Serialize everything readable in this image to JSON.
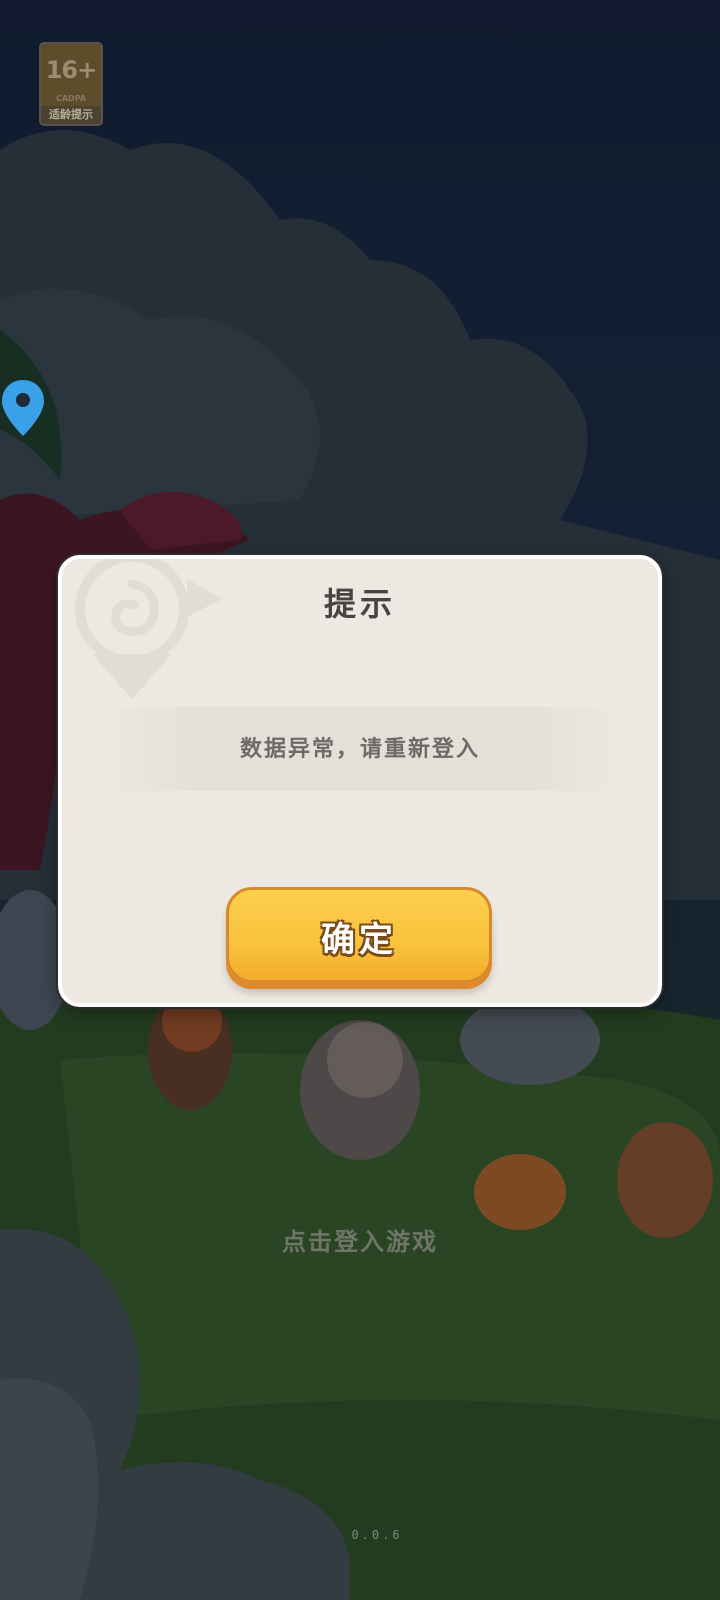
{
  "age_rating": {
    "number": "16+",
    "sub_text": "CADPA",
    "caption": "适龄提示"
  },
  "dialog": {
    "title": "提示",
    "message": "数据异常，请重新登入",
    "confirm_label": "确定"
  },
  "start_prompt": "点击登入游戏",
  "version": "0.0.6",
  "colors": {
    "dialog_bg": "#ede9e2",
    "button_yellow": "#f9c23d",
    "button_border": "#d88a2a",
    "pin_blue": "#3aa0e8"
  },
  "icons": {
    "location": "location-pin-icon",
    "emblem": "dialog-emblem"
  }
}
